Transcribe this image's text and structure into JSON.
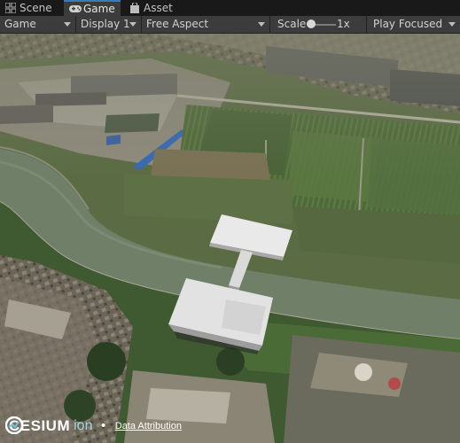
{
  "tabs": [
    {
      "label": "Scene",
      "icon": "grid-icon"
    },
    {
      "label": "Game",
      "icon": "gamepad-icon",
      "active": true
    },
    {
      "label": "Asset Store",
      "icon": "bag-icon"
    }
  ],
  "toolbar": {
    "view_mode": "Game",
    "display": "Display 1",
    "aspect": "Free Aspect",
    "scale_label": "Scale",
    "scale_value": "1x",
    "play_mode": "Play Focused"
  },
  "credits": {
    "logo_text": "CESIUM",
    "ion_text": "ion",
    "separator": "•",
    "attribution": "Data Attribution"
  },
  "colors": {
    "accent": "#3a79bb",
    "panel": "#3c3c3c",
    "tabbar": "#191919"
  }
}
